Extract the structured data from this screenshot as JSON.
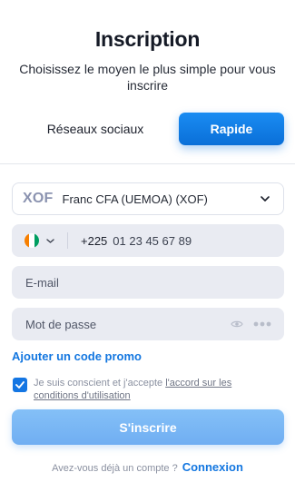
{
  "header": {
    "title": "Inscription",
    "subtitle": "Choisissez le moyen le plus simple pour vous inscrire"
  },
  "tabs": [
    {
      "label": "Réseaux sociaux",
      "active": false
    },
    {
      "label": "Rapide",
      "active": true
    }
  ],
  "currency": {
    "code": "XOF",
    "name": "Franc CFA (UEMOA) (XOF)",
    "icon": "chevron-down-icon"
  },
  "phone": {
    "country_flag": "flag-cote-divoire",
    "flag_colors": [
      "#f77f00",
      "#ffffff",
      "#009e60"
    ],
    "dial_code": "+225",
    "placeholder": "01 23 45 67 89"
  },
  "email": {
    "placeholder": "E-mail"
  },
  "password": {
    "placeholder": "Mot de passe",
    "icons": [
      "eye-icon",
      "more-dots-icon"
    ]
  },
  "promo": {
    "label": "Ajouter un code promo"
  },
  "consent": {
    "checked": true,
    "text": "Je suis conscient et j'accepte ",
    "link": "l'accord sur les conditions d'utilisation"
  },
  "submit": {
    "label": "S'inscrire"
  },
  "login": {
    "prompt": "Avez-vous déjà un compte ?",
    "link": "Connexion"
  },
  "colors": {
    "accent": "#1477e0",
    "button_active": "#0a6fd8",
    "submit_disabled": "#7ab6f4",
    "field_bg": "#e9ebf2"
  }
}
